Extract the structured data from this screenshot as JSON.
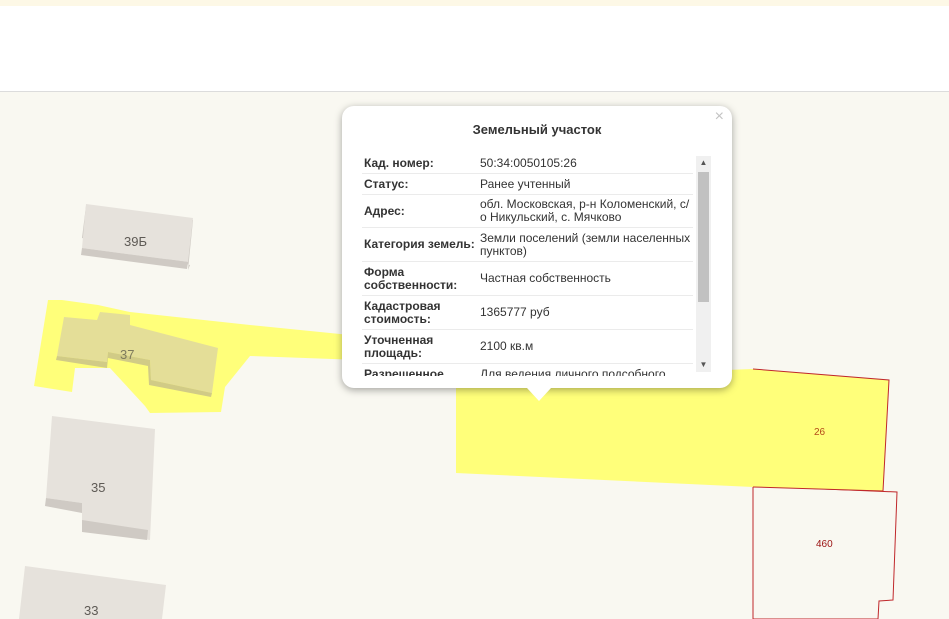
{
  "map": {
    "buildings": [
      "39Б",
      "37",
      "35",
      "33"
    ],
    "parcels": [
      "26",
      "460"
    ]
  },
  "popup": {
    "title": "Земельный участок",
    "close_glyph": "×",
    "rows": [
      {
        "label": "Кад. номер:",
        "value": "50:34:0050105:26"
      },
      {
        "label": "Статус:",
        "value": "Ранее учтенный"
      },
      {
        "label": "Адрес:",
        "value": "обл. Московская, р-н Коломенский, с/о Никульский, с. Мячково"
      },
      {
        "label": "Категория земель:",
        "value": "Земли поселений (земли населенных пунктов)"
      },
      {
        "label": "Форма собственности:",
        "value": "Частная собственность"
      },
      {
        "label": "Кадастровая стоимость:",
        "value": "1365777 руб"
      },
      {
        "label": "Уточненная площадь:",
        "value": "2100 кв.м"
      },
      {
        "label": "Разрешенное",
        "value": "Для ведения личного подсобного"
      }
    ]
  },
  "colors": {
    "parcel_fill": "#ffff7a",
    "parcel_border_red": "#c0282b",
    "building_fill": "#e6e2dc",
    "map_background": "#f9f8f1"
  }
}
